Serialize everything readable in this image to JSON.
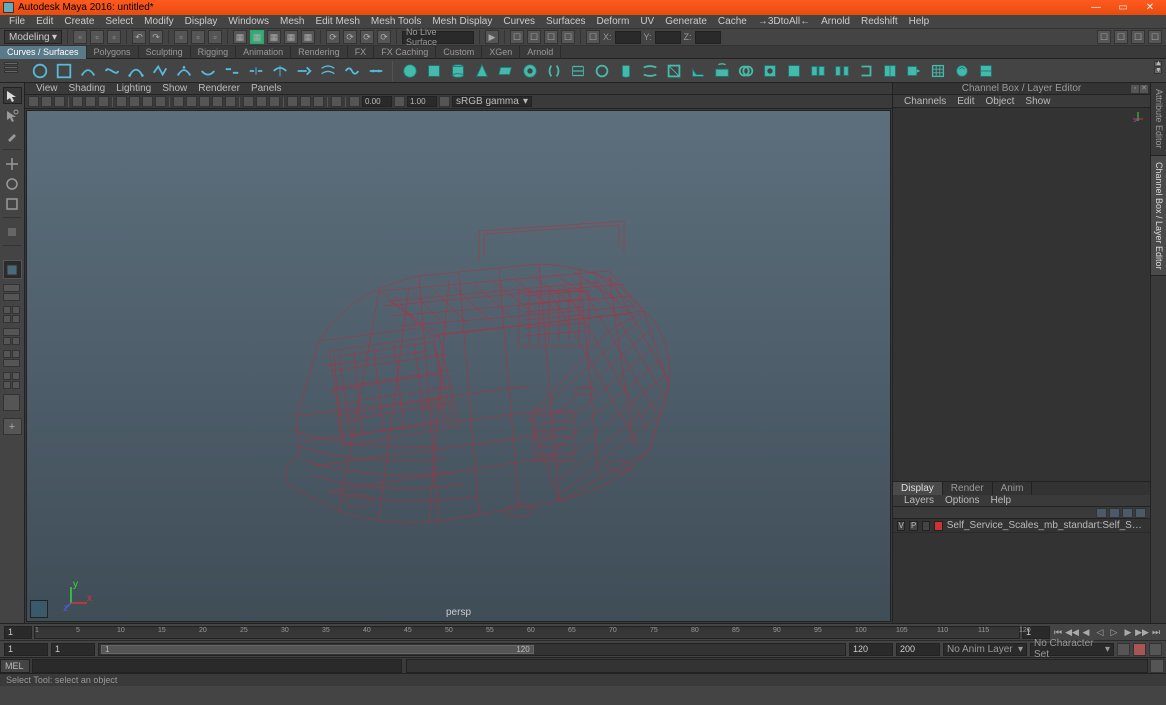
{
  "title": "Autodesk Maya 2016: untitled*",
  "menubar": [
    "File",
    "Edit",
    "Create",
    "Select",
    "Modify",
    "Display",
    "Windows",
    "Mesh",
    "Edit Mesh",
    "Mesh Tools",
    "Mesh Display",
    "Curves",
    "Surfaces",
    "Deform",
    "UV",
    "Generate",
    "Cache",
    "→3DtoAll←",
    "Arnold",
    "Redshift",
    "Help"
  ],
  "modeling_label": "Modeling",
  "nolive": "No Live Surface",
  "mainbar_inputs": {
    "x": "X:",
    "xv": "",
    "y": "Y:",
    "yv": "",
    "z": "Z:",
    "zv": ""
  },
  "shelf_tabs": [
    "Curves / Surfaces",
    "Polygons",
    "Sculpting",
    "Rigging",
    "Animation",
    "Rendering",
    "FX",
    "FX Caching",
    "Custom",
    "XGen",
    "Arnold"
  ],
  "shelf_active": 0,
  "vp_menu": [
    "View",
    "Shading",
    "Lighting",
    "Show",
    "Renderer",
    "Panels"
  ],
  "vp_toolbar": {
    "val1": "0.00",
    "val2": "1.00",
    "dd": "sRGB gamma"
  },
  "persp": "persp",
  "right_panel": {
    "title": "Channel Box / Layer Editor",
    "menu": [
      "Channels",
      "Edit",
      "Object",
      "Show"
    ],
    "tabs": [
      "Display",
      "Render",
      "Anim"
    ],
    "tabs_active": 0,
    "menu2": [
      "Layers",
      "Options",
      "Help"
    ],
    "layer": {
      "v": "V",
      "p": "P",
      "name": "Self_Service_Scales_mb_standart:Self_Service_Scales"
    }
  },
  "right_tabs": [
    "Attribute Editor",
    "Channel Box / Layer Editor"
  ],
  "timeslider": {
    "start": "1",
    "end": "120",
    "cur": "1",
    "ticks": [
      1,
      5,
      10,
      15,
      20,
      25,
      30,
      35,
      40,
      45,
      50,
      55,
      60,
      65,
      70,
      75,
      80,
      85,
      90,
      95,
      100,
      105,
      110,
      115,
      120
    ]
  },
  "rangeslider": {
    "a": "1",
    "b": "1",
    "c": "120",
    "d": "120",
    "e": "200",
    "anim": "No Anim Layer",
    "charset": "No Character Set"
  },
  "cmd": "MEL",
  "help": "Select Tool: select an object"
}
